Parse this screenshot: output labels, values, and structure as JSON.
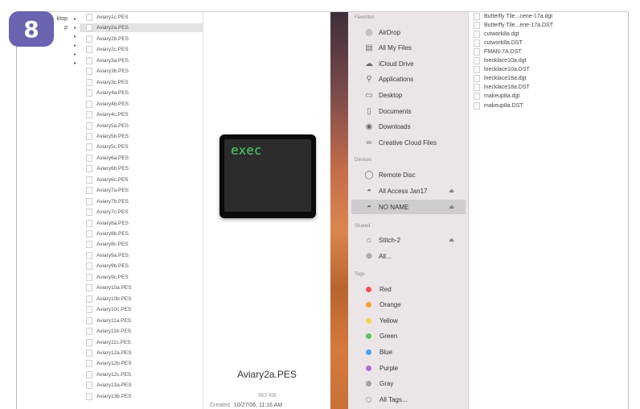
{
  "badge": "8",
  "col0": [
    {
      "label": "ktop",
      "arrow": "▸"
    },
    {
      "label": "p",
      "arrow": "▸"
    },
    {
      "label": "",
      "arrow": "▸"
    },
    {
      "label": "",
      "arrow": "▸"
    },
    {
      "label": "",
      "arrow": "▸"
    },
    {
      "label": "",
      "arrow": "▸"
    }
  ],
  "files": [
    "Aviary1c.PES",
    "Aviary2a.PES",
    "Aviary2b.PES",
    "Aviary2c.PES",
    "Aviary3a.PES",
    "Aviary3b.PES",
    "Aviary3c.PES",
    "Aviary4a.PES",
    "Aviary4b.PES",
    "Aviary4c.PES",
    "Aviary5a.PES",
    "Aviary5b.PES",
    "Aviary5c.PES",
    "Aviary6a.PES",
    "Aviary6b.PES",
    "Aviary6c.PES",
    "Aviary7a.PES",
    "Aviary7b.PES",
    "Aviary7c.PES",
    "Aviary8a.PES",
    "Aviary8b.PES",
    "Aviary8c.PES",
    "Aviary9a.PES",
    "Aviary9b.PES",
    "Aviary9c.PES",
    "Aviary10a.PES",
    "Aviary10b.PES",
    "Aviary10c.PES",
    "Aviary11a.PES",
    "Aviary11b.PES",
    "Aviary11c.PES",
    "Aviary12a.PES",
    "Aviary12b.PES",
    "Aviary12c.PES",
    "Aviary13a.PES",
    "Aviary13b.PES"
  ],
  "selected_file": "Aviary2a.PES",
  "preview": {
    "terminal_text": "exec",
    "file_name": "Aviary2a.PES",
    "size": "363 KB",
    "created_label": "Created",
    "created_value": "10/27/06, 11:16 AM"
  },
  "sidebar": {
    "favorites_label": "Favorites",
    "favorites": [
      {
        "label": "AirDrop",
        "icon": "airdrop-icon"
      },
      {
        "label": "All My Files",
        "icon": "all-files-icon"
      },
      {
        "label": "iCloud Drive",
        "icon": "cloud-icon"
      },
      {
        "label": "Applications",
        "icon": "applications-icon"
      },
      {
        "label": "Desktop",
        "icon": "desktop-icon"
      },
      {
        "label": "Documents",
        "icon": "documents-icon"
      },
      {
        "label": "Downloads",
        "icon": "downloads-icon"
      },
      {
        "label": "Creative Cloud Files",
        "icon": "creative-cloud-icon"
      }
    ],
    "devices_label": "Devices",
    "devices": [
      {
        "label": "Remote Disc",
        "icon": "disc-icon",
        "eject": ""
      },
      {
        "label": "All Access Jan17",
        "icon": "drive-icon",
        "eject": "⏏"
      },
      {
        "label": "NO NAME",
        "icon": "drive-icon",
        "eject": "⏏"
      }
    ],
    "active_device": "NO NAME",
    "shared_label": "Shared",
    "shared": [
      {
        "label": "Stitch-2",
        "icon": "network-computer-icon",
        "eject": "⏏"
      },
      {
        "label": "All...",
        "icon": "globe-icon",
        "eject": ""
      }
    ],
    "tags_label": "Tags",
    "tags": [
      {
        "label": "Red",
        "color": "#f0524f"
      },
      {
        "label": "Orange",
        "color": "#f5a23a"
      },
      {
        "label": "Yellow",
        "color": "#f5d547"
      },
      {
        "label": "Green",
        "color": "#5cc65a"
      },
      {
        "label": "Blue",
        "color": "#4aa3f0"
      },
      {
        "label": "Purple",
        "color": "#b36ad8"
      },
      {
        "label": "Gray",
        "color": "#a0a0a0"
      },
      {
        "label": "All Tags...",
        "color": ""
      }
    ]
  },
  "right_files": [
    "Butterfly Tile...cene-17a.dgt",
    "Butterfly Tile...ene-17a.DST",
    "cutwork8a.dgt",
    "cutwork8a.DST",
    "FMAN-7A.DST",
    "lnecklace10a.dgt",
    "lnecklace10a.DST",
    "lnecklace18a.dgt",
    "lnecklace18a.DST",
    "makeup8a.dgt",
    "makeup8a.DST"
  ]
}
